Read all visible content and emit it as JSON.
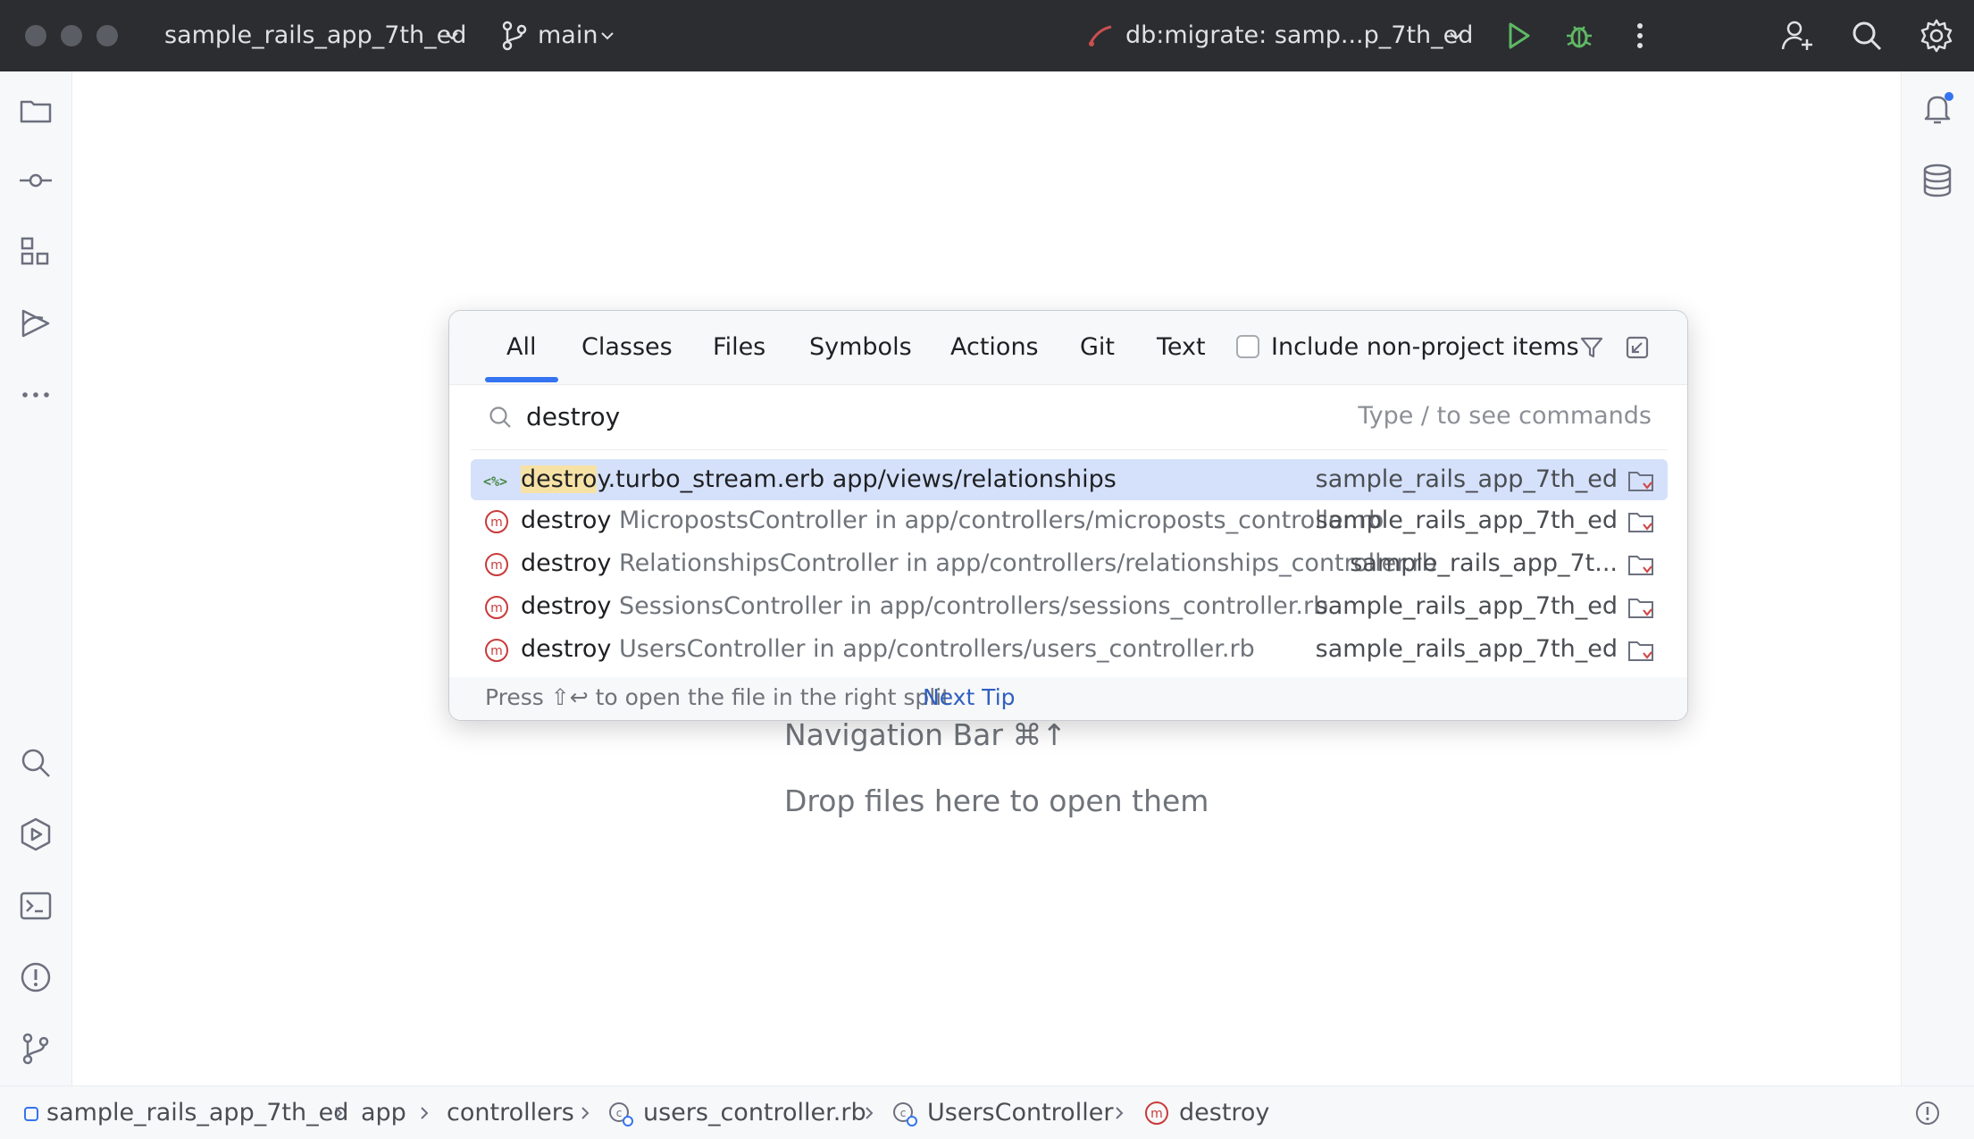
{
  "titlebar": {
    "project": "sample_rails_app_7th_ed",
    "branch": "main",
    "run_config": "db:migrate: samp...p_7th_ed"
  },
  "popup": {
    "tabs": [
      "All",
      "Classes",
      "Files",
      "Symbols",
      "Actions",
      "Git",
      "Text"
    ],
    "active_tab": "All",
    "include_label": "Include non-project items",
    "include_checked": false,
    "search_value": "destroy",
    "search_hint": "Type / to see commands",
    "results": [
      {
        "icon": "erb-file-icon",
        "highlight": "destro",
        "name_rest": "y.turbo_stream.erb",
        "detail": "app/views/relationships",
        "location": "sample_rails_app_7th_ed",
        "selected": true
      },
      {
        "icon": "method-icon",
        "name": "destroy",
        "detail": "MicropostsController in app/controllers/microposts_controller.rb",
        "location": "sample_rails_app_7th_ed",
        "selected": false
      },
      {
        "icon": "method-icon",
        "name": "destroy",
        "detail": "RelationshipsController in app/controllers/relationships_controller.rb",
        "location": "sample_rails_app_7t...",
        "selected": false
      },
      {
        "icon": "method-icon",
        "name": "destroy",
        "detail": "SessionsController in app/controllers/sessions_controller.rb",
        "location": "sample_rails_app_7th_ed",
        "selected": false
      },
      {
        "icon": "method-icon",
        "name": "destroy",
        "detail": "UsersController in app/controllers/users_controller.rb",
        "location": "sample_rails_app_7th_ed",
        "selected": false
      }
    ],
    "footer_text": "Press ⇧↩ to open the file in the right split",
    "next_tip": "Next Tip"
  },
  "editor_hints": {
    "nav_bar": "Navigation Bar ⌘↑",
    "drop_files": "Drop files here to open them"
  },
  "breadcrumbs": [
    "sample_rails_app_7th_ed",
    "app",
    "controllers",
    "users_controller.rb",
    "UsersController",
    "destroy"
  ],
  "colors": {
    "titlebar_bg": "#2b2d30",
    "accent": "#3574f0",
    "selection": "#d5e1fb",
    "method_red": "#c93b3b",
    "run_green": "#5fb865"
  }
}
